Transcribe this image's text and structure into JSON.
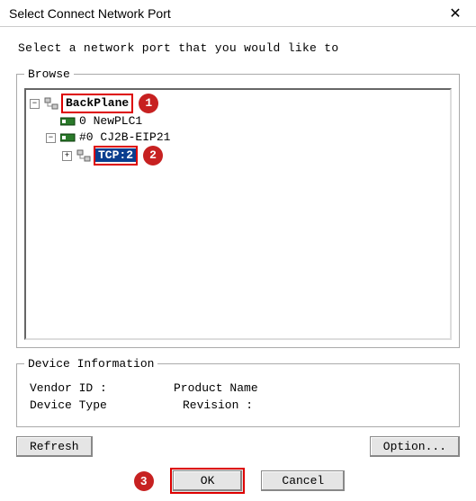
{
  "window": {
    "title": "Select Connect Network Port"
  },
  "instruction": "Select a network port that you would like to",
  "browse_legend": "Browse",
  "tree": {
    "root_label": "BackPlane",
    "callout1": "1",
    "child1": "0 NewPLC1",
    "child2": "#0 CJ2B-EIP21",
    "tcp": "TCP:2",
    "callout2": "2"
  },
  "device_info": {
    "legend": "Device Information",
    "vendor_label": "Vendor ID :",
    "product_label": "Product Name",
    "type_label": "Device Type",
    "revision_label": "Revision :"
  },
  "buttons": {
    "refresh": "Refresh",
    "option": "Option...",
    "ok": "OK",
    "cancel": "Cancel",
    "callout3": "3"
  }
}
